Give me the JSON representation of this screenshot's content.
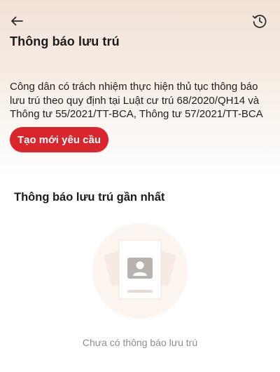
{
  "header": {
    "back_icon": "arrow-left-icon",
    "history_icon": "history-clock-icon",
    "title": "Thông báo lưu trú"
  },
  "intro": {
    "description": "Công dân có trách nhiệm thực hiện thủ tục thông báo lưu trú theo quy định tại Luật cư trú 68/2020/QH14 và Thông tư 55/2021/TT-BCA, Thông tư 57/2021/TT-BCA",
    "create_button_label": "Tạo mới yêu cầu"
  },
  "recent": {
    "title": "Thông báo lưu trú gần nhất",
    "empty_message": "Chưa có thông báo lưu trú",
    "empty_icon": "empty-document-illustration"
  },
  "colors": {
    "accent": "#d8262c",
    "header_gradient_top": "#f2e3d8",
    "muted_text": "#8e8e8e"
  }
}
